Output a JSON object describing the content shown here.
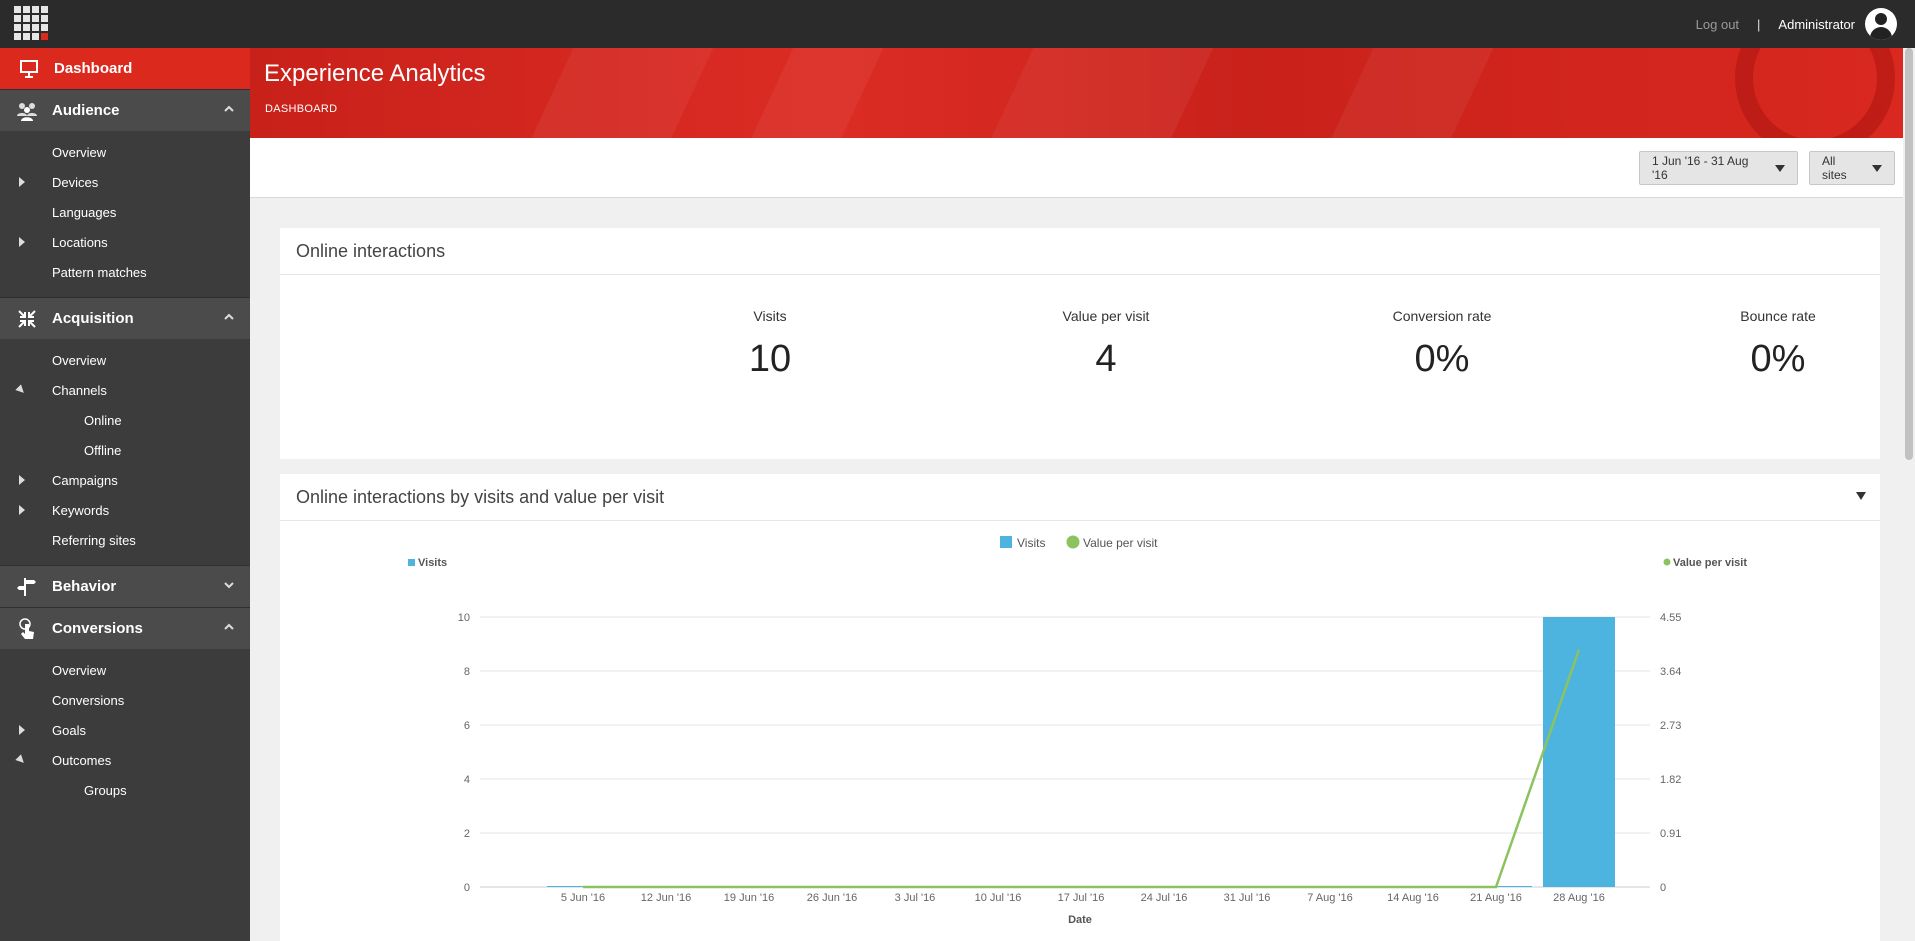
{
  "topbar": {
    "logout": "Log out",
    "separator": "|",
    "user": "Administrator"
  },
  "sidebar": {
    "dashboard": "Dashboard",
    "audience": {
      "label": "Audience",
      "items": [
        "Overview",
        "Devices",
        "Languages",
        "Locations",
        "Pattern matches"
      ]
    },
    "acquisition": {
      "label": "Acquisition",
      "items": [
        "Overview",
        "Channels",
        "Online",
        "Offline",
        "Campaigns",
        "Keywords",
        "Referring sites"
      ]
    },
    "behavior": {
      "label": "Behavior"
    },
    "conversions": {
      "label": "Conversions",
      "items": [
        "Overview",
        "Conversions",
        "Goals",
        "Outcomes",
        "Groups"
      ]
    }
  },
  "header": {
    "title": "Experience Analytics",
    "subtitle": "DASHBOARD"
  },
  "filters": {
    "date_range": "1 Jun '16 - 31 Aug '16",
    "sites": "All sites"
  },
  "panel1": {
    "title": "Online interactions",
    "kpis": [
      {
        "label": "Visits",
        "value": "10"
      },
      {
        "label": "Value per visit",
        "value": "4"
      },
      {
        "label": "Conversion rate",
        "value": "0%"
      },
      {
        "label": "Bounce rate",
        "value": "0%"
      }
    ]
  },
  "panel2": {
    "title": "Online interactions by visits and value per visit"
  },
  "colors": {
    "accent": "#dc291e",
    "visits": "#4db4e0",
    "value_per_visit": "#8dc261"
  },
  "chart_data": {
    "type": "bar",
    "xlabel": "Date",
    "categories": [
      "5 Jun '16",
      "12 Jun '16",
      "19 Jun '16",
      "26 Jun '16",
      "3 Jul '16",
      "10 Jul '16",
      "17 Jul '16",
      "24 Jul '16",
      "31 Jul '16",
      "7 Aug '16",
      "14 Aug '16",
      "21 Aug '16",
      "28 Aug '16"
    ],
    "legend": [
      "Visits",
      "Value per visit"
    ],
    "y_left": {
      "label": "Visits",
      "ticks": [
        "0",
        "2",
        "4",
        "6",
        "8",
        "10"
      ],
      "lim": [
        0,
        10
      ]
    },
    "y_right": {
      "label": "Value per visit",
      "ticks": [
        "0",
        "0.91",
        "1.82",
        "2.73",
        "3.64",
        "4.55"
      ],
      "lim": [
        0,
        4.55
      ]
    },
    "series": [
      {
        "name": "Visits",
        "type": "bar",
        "axis": "left",
        "values": [
          0,
          0,
          0,
          0,
          0,
          0,
          0,
          0,
          0,
          0,
          0,
          0,
          10
        ]
      },
      {
        "name": "Value per visit",
        "type": "line",
        "axis": "right",
        "values": [
          0,
          0,
          0,
          0,
          0,
          0,
          0,
          0,
          0,
          0,
          0,
          0,
          4
        ]
      }
    ],
    "grid": true
  }
}
